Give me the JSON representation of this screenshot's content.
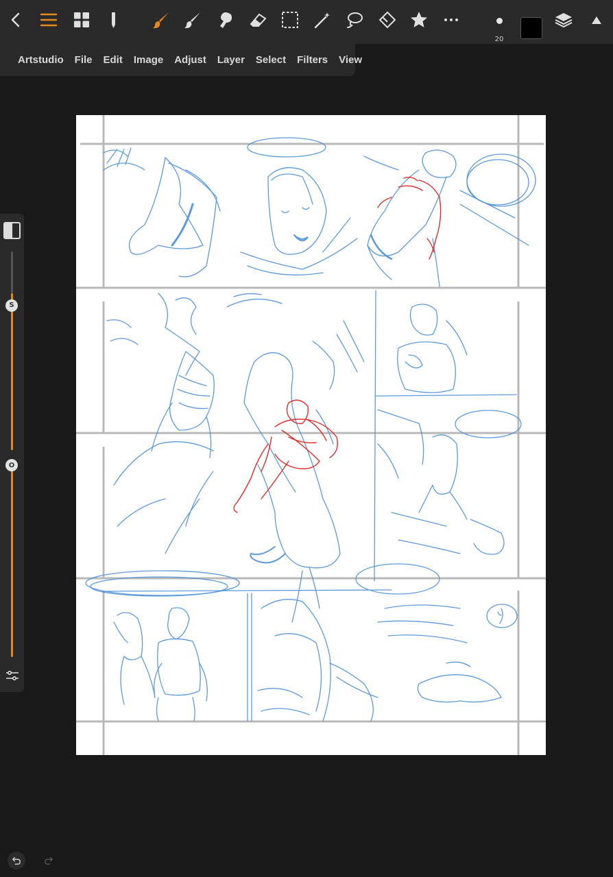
{
  "menu": {
    "items": [
      "Artstudio",
      "File",
      "Edit",
      "Image",
      "Adjust",
      "Layer",
      "Select",
      "Filters",
      "View"
    ]
  },
  "toolbar": {
    "brush_size": "20",
    "color": "#000000",
    "accent": "#e8871e",
    "icons": [
      "back-icon",
      "menu-icon",
      "gallery-grid-icon",
      "pencil-icon",
      "paint-brush-icon",
      "smudge-icon",
      "blur-icon",
      "eraser-icon",
      "rect-select-icon",
      "magic-wand-icon",
      "lasso-icon",
      "transform-icon",
      "star-icon",
      "more-icon",
      "layers-icon",
      "collapse-icon"
    ]
  },
  "side_slider": {
    "size_label": "S",
    "opacity_label": "O",
    "size_level": 0.79,
    "opacity_level": 0.5
  },
  "sketch": {
    "blue": "#4a8fd6",
    "red": "#e02a2a",
    "panel_line": "#b5b5b5"
  }
}
